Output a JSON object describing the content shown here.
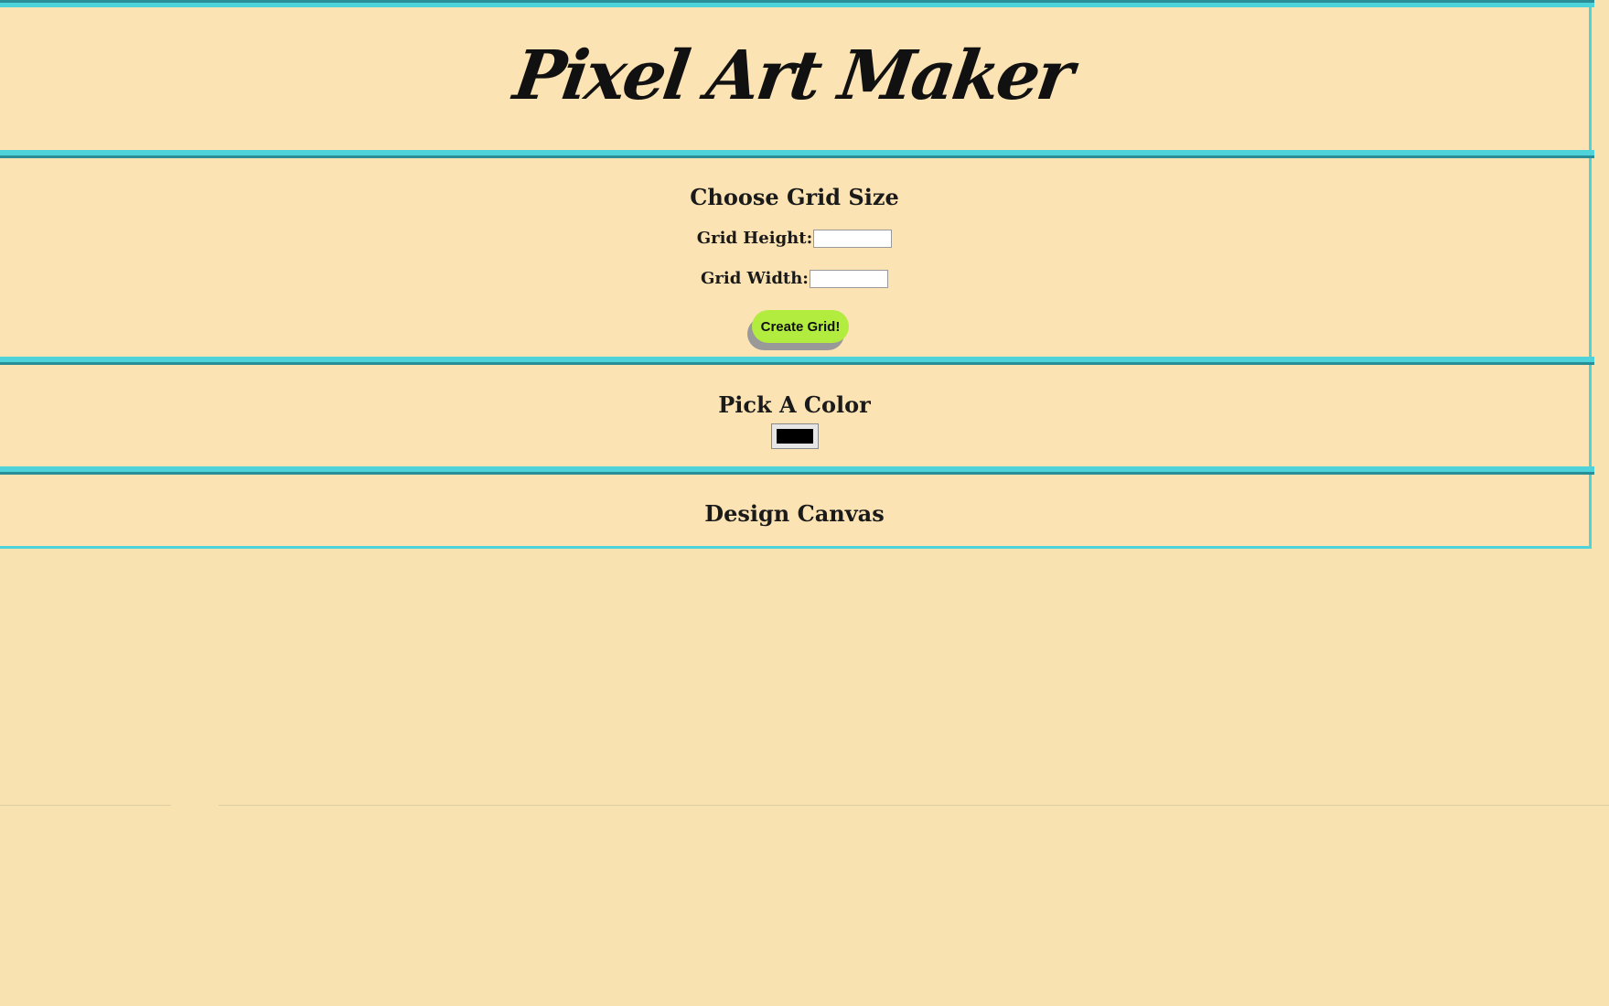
{
  "header": {
    "title": "Pixel Art Maker"
  },
  "grid_size": {
    "heading": "Choose Grid Size",
    "height_label": "Grid Height:",
    "height_value": "",
    "width_label": "Grid Width:",
    "width_value": "",
    "create_button_label": "Create Grid!"
  },
  "color": {
    "heading": "Pick A Color",
    "selected_color": "#000000"
  },
  "canvas": {
    "heading": "Design Canvas"
  },
  "colors": {
    "background": "#f8e3b0",
    "section_bg": "#fbe3b4",
    "border": "#4fd3da",
    "button": "#b2ec3e"
  }
}
